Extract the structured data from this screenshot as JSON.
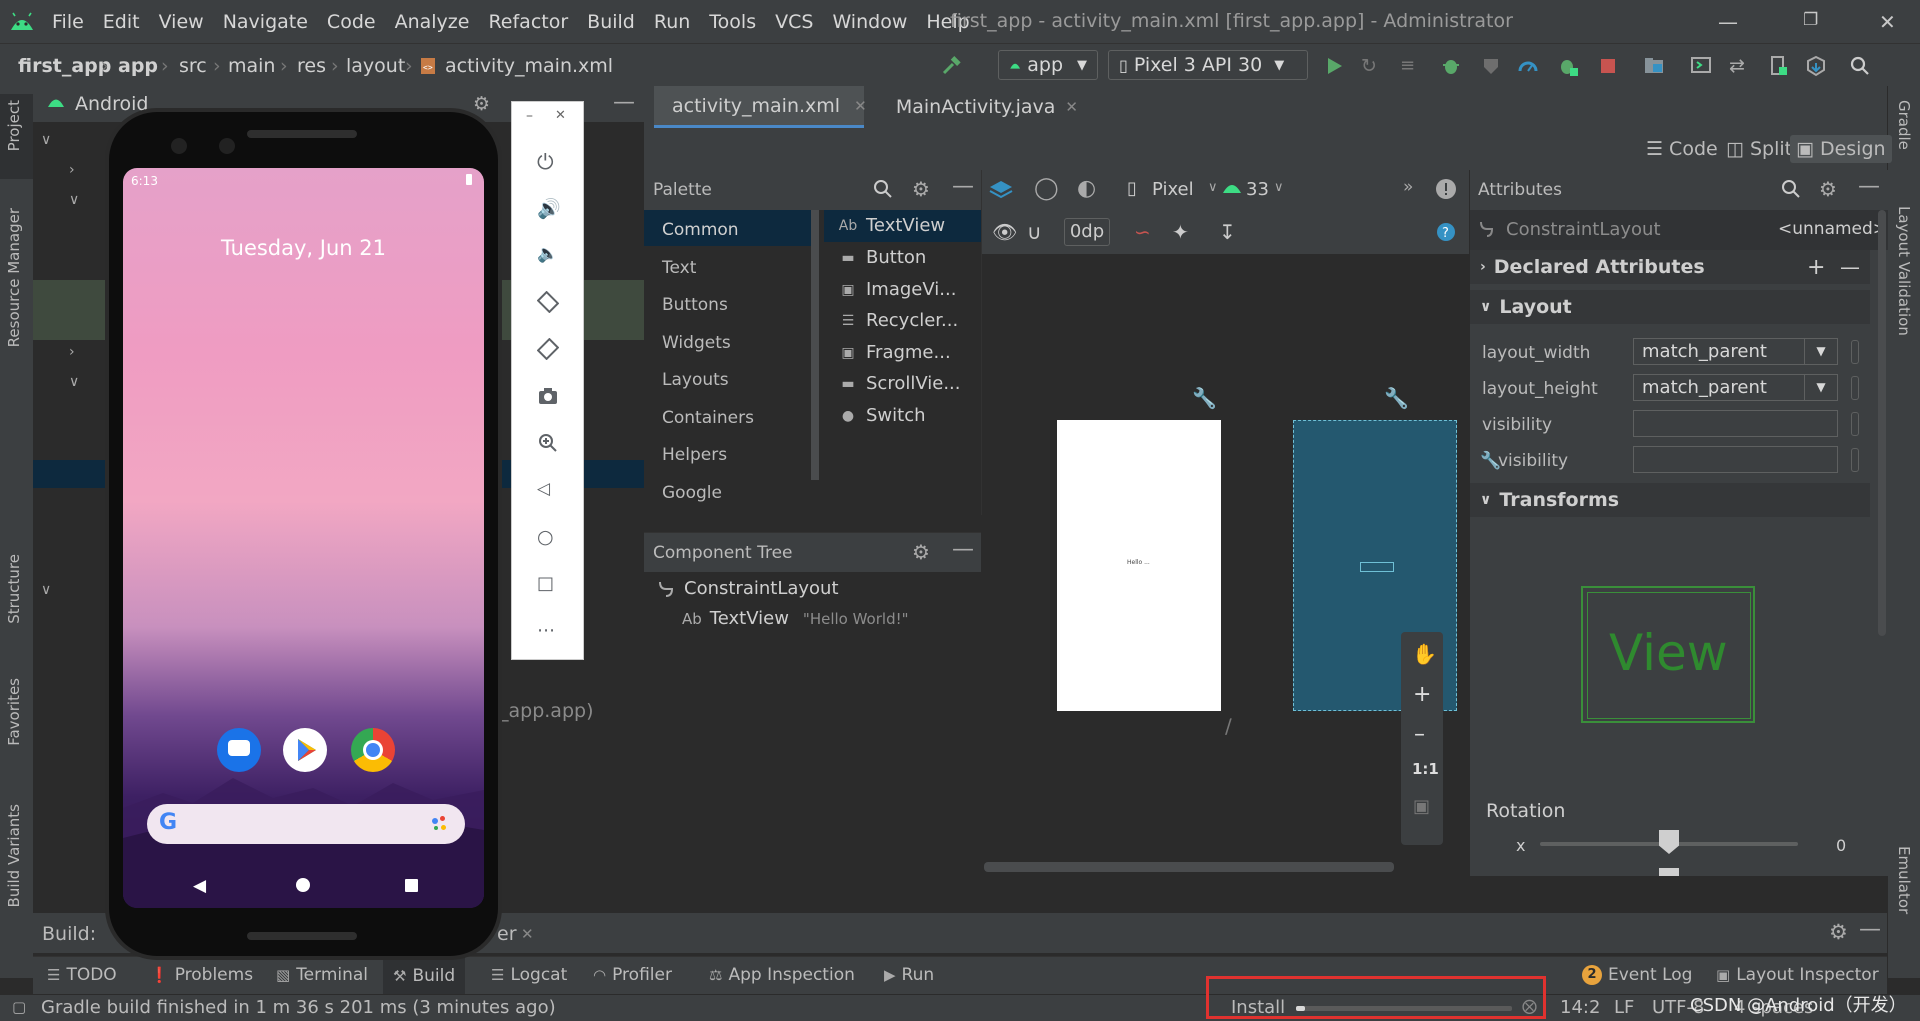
{
  "menu": [
    "File",
    "Edit",
    "View",
    "Navigate",
    "Code",
    "Analyze",
    "Refactor",
    "Build",
    "Run",
    "Tools",
    "VCS",
    "Window",
    "Help"
  ],
  "window_title": "first_app - activity_main.xml [first_app.app] - Administrator",
  "breadcrumbs": [
    "first_app",
    "app",
    "src",
    "main",
    "res",
    "layout",
    "activity_main.xml"
  ],
  "run_config": "app",
  "device": "Pixel 3 API 30",
  "left_strip": [
    "Project",
    "Resource Manager",
    "Structure",
    "Favorites",
    "Build Variants"
  ],
  "right_strip": [
    "Gradle",
    "Layout Validation",
    "Emulator"
  ],
  "project_panel": {
    "title": "Android",
    "partial_text": "_app.app)"
  },
  "editor_tabs": [
    "activity_main.xml",
    "MainActivity.java"
  ],
  "view_modes": [
    "Code",
    "Split",
    "Design"
  ],
  "palette": {
    "title": "Palette",
    "categories": [
      "Common",
      "Text",
      "Buttons",
      "Widgets",
      "Layouts",
      "Containers",
      "Helpers",
      "Google"
    ],
    "items": [
      {
        "icon": "Ab",
        "label": "TextView"
      },
      {
        "icon": "▬",
        "label": "Button"
      },
      {
        "icon": "▣",
        "label": "ImageVi..."
      },
      {
        "icon": "☰",
        "label": "Recycler..."
      },
      {
        "icon": "▣",
        "label": "Fragme..."
      },
      {
        "icon": "▬",
        "label": "ScrollVie..."
      },
      {
        "icon": "●",
        "label": "Switch"
      }
    ]
  },
  "component_tree": {
    "title": "Component Tree",
    "root": "ConstraintLayout",
    "child_prefix": "Ab",
    "child": "TextView",
    "child_text": "\"Hello World!\""
  },
  "design_toolbar": {
    "device": "Pixel",
    "api": "33",
    "margin": "0dp"
  },
  "canvas": {
    "zoom_label": "1:1",
    "preview_text": "Hello ..."
  },
  "attributes": {
    "title": "Attributes",
    "component": "ConstraintLayout",
    "id": "<unnamed>",
    "sections": [
      "Declared Attributes",
      "Layout",
      "Transforms"
    ],
    "rows": [
      {
        "label": "layout_width",
        "value": "match_parent"
      },
      {
        "label": "layout_height",
        "value": "match_parent"
      },
      {
        "label": "visibility",
        "value": ""
      },
      {
        "label": "visibility",
        "value": ""
      }
    ],
    "view_preview": "View",
    "rotation_label": "Rotation",
    "rotation_axis": "x",
    "rotation_value": "0"
  },
  "build_panel": {
    "label": "Build:",
    "tab_fragment": "er"
  },
  "bottom_tabs": [
    "TODO",
    "Problems",
    "Terminal",
    "Build",
    "Logcat",
    "Profiler",
    "App Inspection",
    "Run"
  ],
  "bottom_right_tabs": [
    "Event Log",
    "Layout Inspector"
  ],
  "event_log_count": "2",
  "status": {
    "message": "Gradle build finished in 1 m 36 s 201 ms (3 minutes ago)",
    "progress_label": "Install",
    "position": "14:2",
    "line_sep": "LF",
    "encoding": "UTF-8",
    "indent": "4 spaces",
    "watermark": "CSDN @Android（开发）"
  },
  "emulator": {
    "time": "6:13",
    "date": "Tuesday, Jun 21"
  }
}
